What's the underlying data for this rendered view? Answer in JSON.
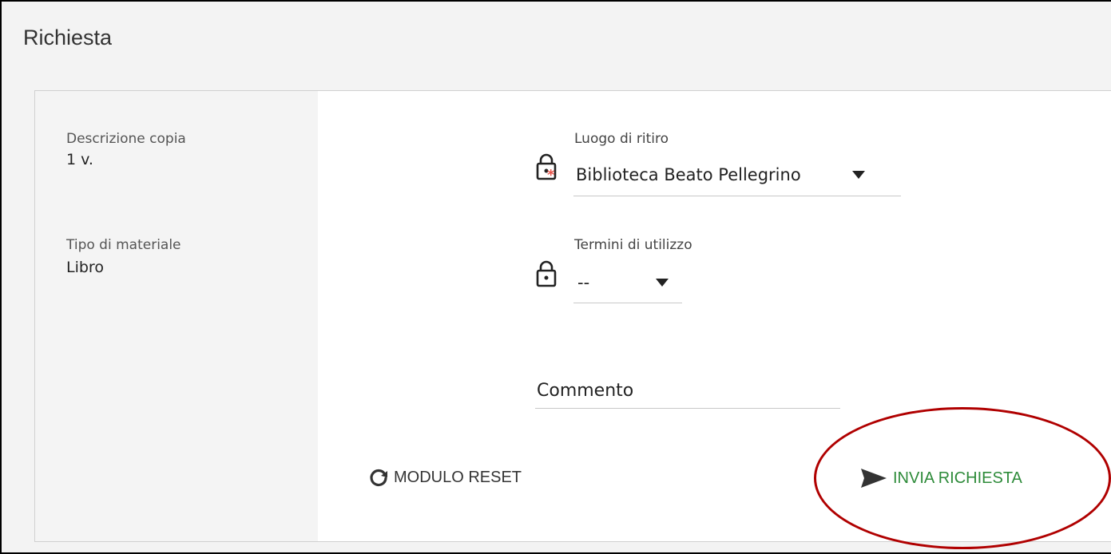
{
  "header": {
    "title": "Richiesta"
  },
  "item_info": {
    "copy_description_label": "Descrizione copia",
    "copy_description_value": "1 v.",
    "material_type_label": "Tipo di materiale",
    "material_type_value": "Libro"
  },
  "form": {
    "pickup": {
      "label": "Luogo di ritiro",
      "value": "Biblioteca Beato Pellegrino",
      "icon": "lock-required-icon",
      "required": true
    },
    "terms": {
      "label": "Termini di utilizzo",
      "value": "--",
      "icon": "lock-icon"
    },
    "comment": {
      "label": "Commento"
    }
  },
  "actions": {
    "reset_label": "MODULO RESET",
    "reset_icon": "refresh-icon",
    "send_label": "INVIA RICHIESTA",
    "send_icon": "send-icon"
  },
  "colors": {
    "send_green": "#2e8b3a",
    "annotation_red": "#b00000",
    "required_star": "#e8534a"
  }
}
